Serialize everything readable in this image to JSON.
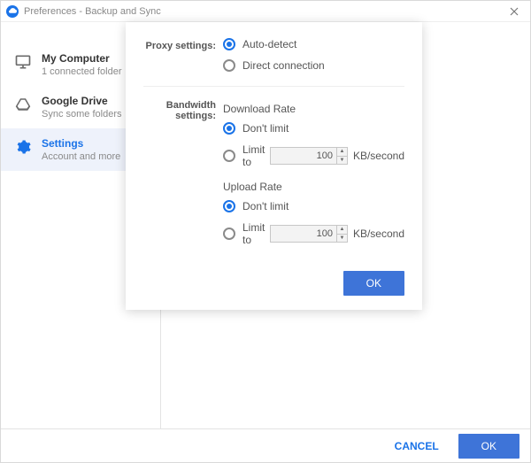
{
  "titlebar": {
    "title": "Preferences - Backup and Sync"
  },
  "sidebar": {
    "items": [
      {
        "title": "My Computer",
        "sub": "1 connected folder"
      },
      {
        "title": "Google Drive",
        "sub": "Sync some folders"
      },
      {
        "title": "Settings",
        "sub": "Account and more"
      }
    ]
  },
  "panel": {
    "proxy_label": "Proxy settings:",
    "proxy": {
      "auto": "Auto-detect",
      "direct": "Direct connection"
    },
    "bandwidth_label": "Bandwidth settings:",
    "download": {
      "title": "Download Rate",
      "dont_limit": "Don't limit",
      "limit_to": "Limit to",
      "value": "100",
      "unit": "KB/second"
    },
    "upload": {
      "title": "Upload Rate",
      "dont_limit": "Don't limit",
      "limit_to": "Limit to",
      "value": "100",
      "unit": "KB/second"
    },
    "ok": "OK"
  },
  "footer": {
    "cancel": "CANCEL",
    "ok": "OK"
  }
}
